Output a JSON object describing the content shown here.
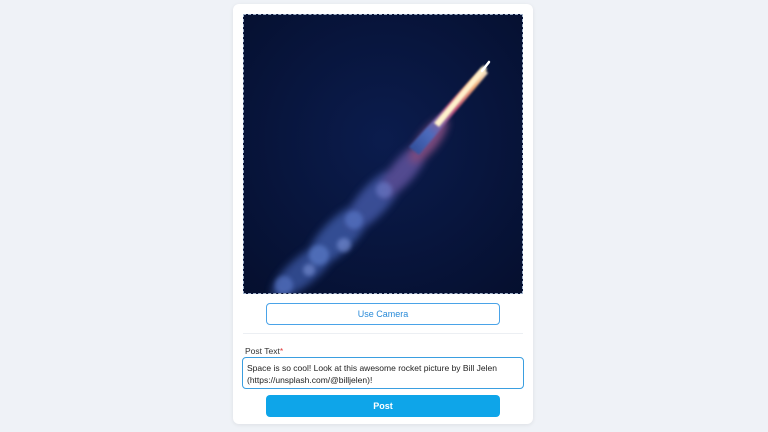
{
  "image_alt": "rocket launch",
  "camera_button": {
    "label": "Use Camera"
  },
  "post_field": {
    "label": "Post Text",
    "required_mark": "*",
    "value": "Space is so cool! Look at this awesome rocket picture by Bill Jelen (https://unsplash.com/@billjelen)!"
  },
  "post_button": {
    "label": "Post"
  },
  "colors": {
    "accent": "#0ea5e9",
    "outline_button": "#4aa3e8",
    "background": "#eff2f7"
  }
}
